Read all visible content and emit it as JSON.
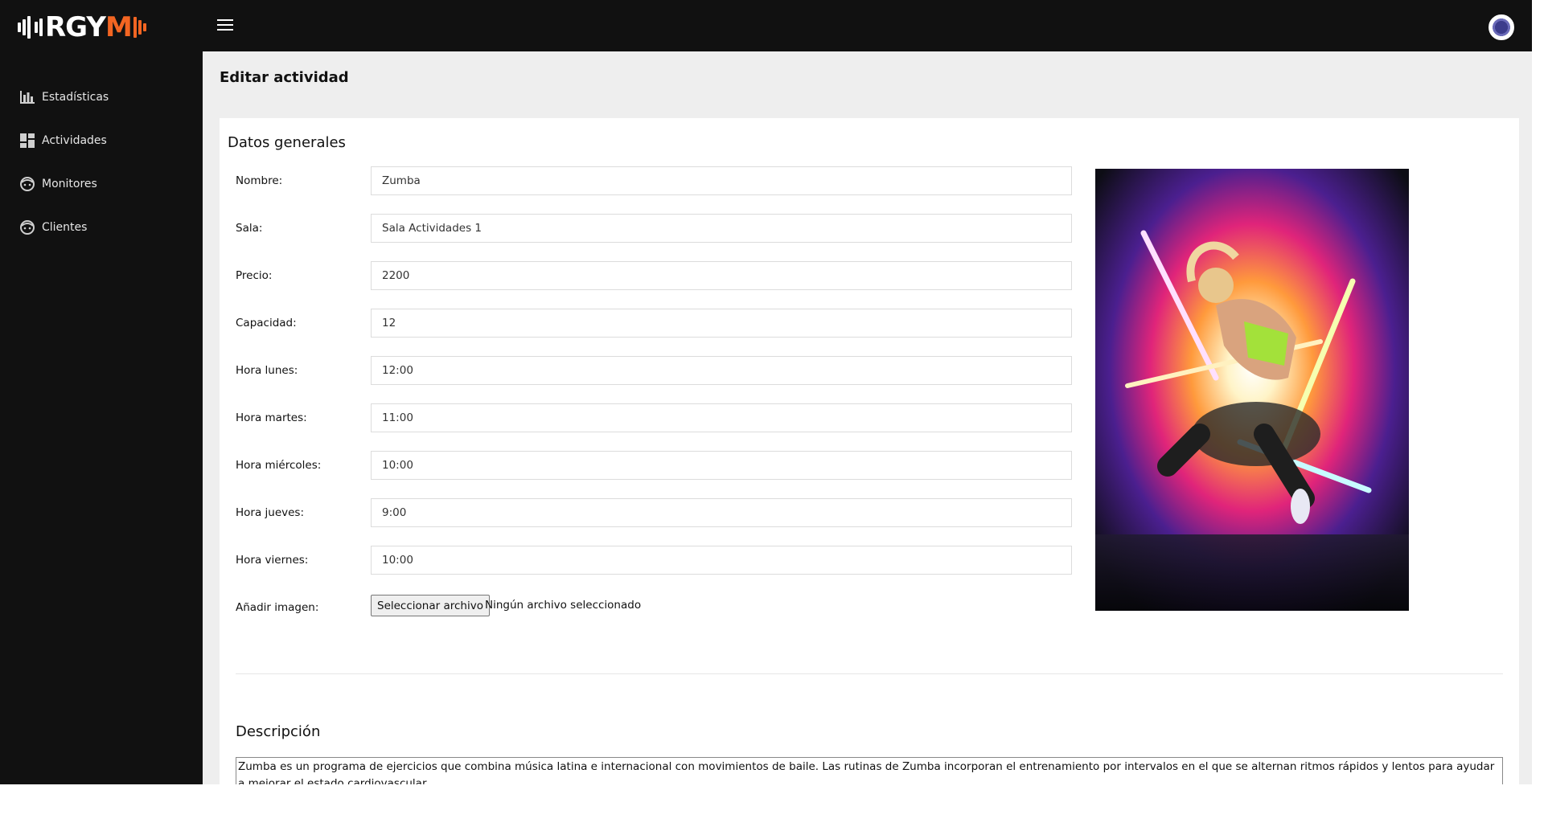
{
  "app": {
    "logo_text_main": "RGY",
    "logo_text_accent": "M",
    "menu_icon": "hamburger-icon",
    "avatar_icon": "user-avatar-icon"
  },
  "sidebar": {
    "items": [
      {
        "label": "Estadísticas",
        "icon": "bar-chart-icon"
      },
      {
        "label": "Actividades",
        "icon": "dashboard-grid-icon"
      },
      {
        "label": "Monitores",
        "icon": "face-icon"
      },
      {
        "label": "Clientes",
        "icon": "face-icon"
      }
    ]
  },
  "page": {
    "title": "Editar actividad"
  },
  "general": {
    "section_title": "Datos generales",
    "fields": [
      {
        "label": "Nombre:",
        "value": "Zumba"
      },
      {
        "label": "Sala:",
        "value": "Sala Actividades 1"
      },
      {
        "label": "Precio:",
        "value": "2200"
      },
      {
        "label": "Capacidad:",
        "value": "12"
      },
      {
        "label": "Hora lunes:",
        "value": "12:00"
      },
      {
        "label": "Hora martes:",
        "value": "11:00"
      },
      {
        "label": "Hora miércoles:",
        "value": "10:00"
      },
      {
        "label": "Hora jueves:",
        "value": "9:00"
      },
      {
        "label": "Hora viernes:",
        "value": "10:00"
      }
    ],
    "image_label": "Añadir imagen:",
    "file_button": "Seleccionar archivo",
    "file_status": "Ningún archivo seleccionado"
  },
  "description": {
    "section_title": "Descripción",
    "text": "Zumba es un programa de ejercicios que combina música latina e internacional con movimientos de baile. Las rutinas de Zumba incorporan el entrenamiento por intervalos en el que se alternan ritmos rápidos y lentos para ayudar a mejorar el estado cardiovascular."
  },
  "colors": {
    "topbar": "#111111",
    "sidebar": "#111111",
    "accent": "#f26522",
    "background": "#eeeeee"
  }
}
